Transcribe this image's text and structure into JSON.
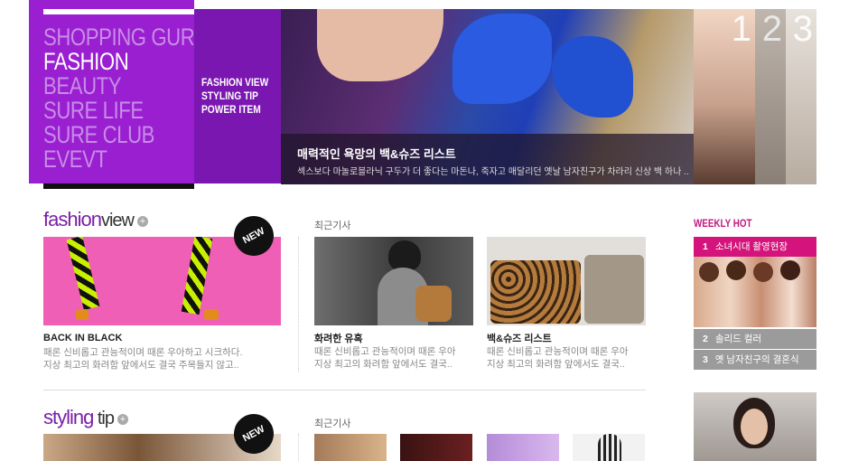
{
  "menu": {
    "items": [
      {
        "label": "SHOPPING GURU",
        "active": false
      },
      {
        "label": "FASHION",
        "active": true
      },
      {
        "label": "BEAUTY",
        "active": false
      },
      {
        "label": "SURE LIFE",
        "active": false
      },
      {
        "label": "SURE CLUB",
        "active": false
      },
      {
        "label": "EVEVT",
        "active": false
      }
    ]
  },
  "submenu": {
    "items": [
      "FASHION VIEW",
      "STYLING TIP",
      "POWER ITEM"
    ]
  },
  "hero": {
    "title": "매력적인 욕망의 백&슈즈 리스트",
    "desc": "섹스보다 마놀로블라닉 구두가 더 좋다는 마돈나, 죽자고 매달리던 옛날 남자친구가 차라리 신상 백 하나 ..",
    "thumbs": [
      "1",
      "2",
      "3"
    ]
  },
  "fashion_view": {
    "title_a": "fashion",
    "title_b": "view",
    "plus": "+",
    "new_badge": "NEW",
    "main": {
      "title": "BACK IN BLACK",
      "desc1": "패론 신비롭고 관능적이며 때론 우아하고 시크하다.",
      "desc2": "지상 최고의 화려함 앞에서도 결국 주목들지 않고.."
    },
    "recent_label": "최근기사",
    "cards": [
      {
        "title": "화려한 유혹",
        "desc1": "때론 신비롭고 관능적이며 때론 우아",
        "desc2": "지상 최고의 화려함 앞에서도 결국.."
      },
      {
        "title": "백&슈즈 리스트",
        "desc1": "때론 신비롭고 관능적이며 때론 우아",
        "desc2": "지상 최고의 화려함 앞에서도 결국.."
      }
    ]
  },
  "styling_tip": {
    "title_a": "styling",
    "title_b": "tip",
    "plus": "+",
    "new_badge": "NEW",
    "recent_label": "최근기사"
  },
  "weekly_hot": {
    "title": "WEEKLY HOT",
    "items": [
      {
        "num": "1",
        "label": "소녀시대 촬영현장",
        "color": "#d4147c"
      },
      {
        "num": "2",
        "label": "솔리드 컬러",
        "color": "#9b9b9b"
      },
      {
        "num": "3",
        "label": "옛 남자친구의 결혼식",
        "color": "#9b9b9b"
      }
    ]
  },
  "colors": {
    "brand_purple": "#9a1fd0",
    "dark_purple": "#7a17b0",
    "hot_pink": "#d4147c"
  }
}
